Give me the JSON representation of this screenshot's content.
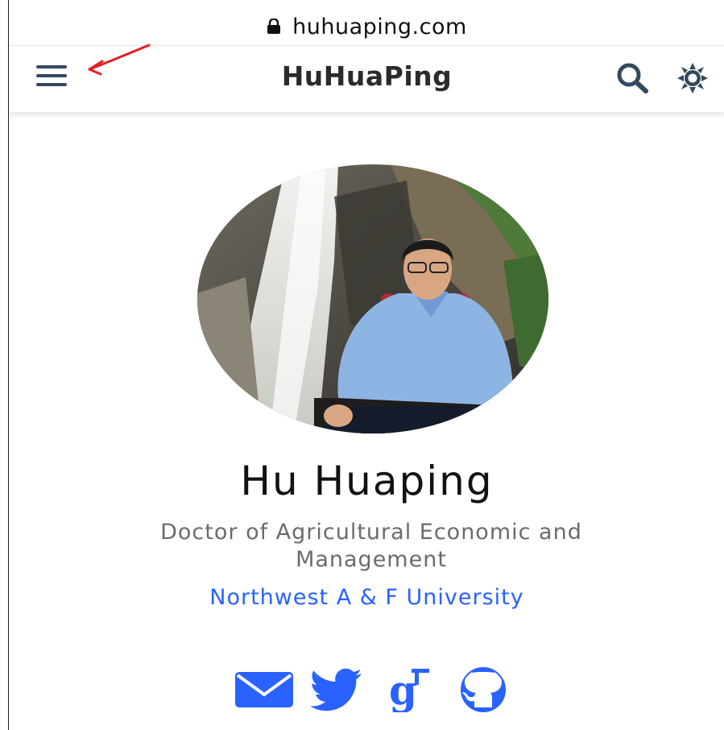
{
  "browser": {
    "url": "huhuaping.com",
    "icon": "lock-icon"
  },
  "header": {
    "title": "HuHuaPing",
    "menu_icon": "hamburger-menu-icon",
    "search_icon": "search-icon",
    "theme_icon": "sun-icon"
  },
  "profile": {
    "name": "Hu Huaping",
    "role": "Doctor of Agricultural Economic and Management",
    "organization": "Northwest A & F University"
  },
  "social": [
    {
      "icon": "email-icon"
    },
    {
      "icon": "twitter-icon"
    },
    {
      "icon": "google-scholar-icon"
    },
    {
      "icon": "github-icon"
    }
  ],
  "colors": {
    "accent": "#2962ff",
    "header_icon": "#34495e",
    "annotation_arrow": "#e02020"
  }
}
